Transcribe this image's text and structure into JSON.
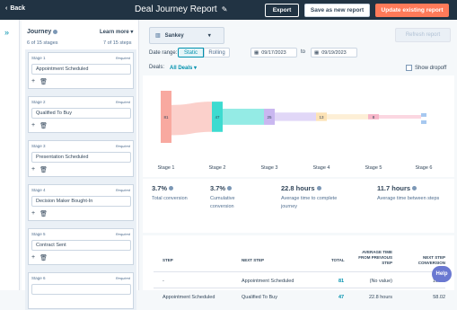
{
  "header": {
    "back_label": "Back",
    "title": "Deal Journey Report",
    "export_label": "Export",
    "save_new_label": "Save as new report",
    "update_label": "Update existing report"
  },
  "journey": {
    "title": "Journey",
    "learn_more": "Learn more",
    "stages_count": "6 of 15 stages",
    "steps_count": "7 of 15 steps",
    "required_label": "Required",
    "stages": [
      {
        "label": "Stage 1",
        "value": "Appointment Scheduled"
      },
      {
        "label": "Stage 2",
        "value": "Qualified To Buy"
      },
      {
        "label": "Stage 3",
        "value": "Presentation Scheduled"
      },
      {
        "label": "Stage 4",
        "value": "Decision Maker Bought-In"
      },
      {
        "label": "Stage 5",
        "value": "Contract Sent"
      },
      {
        "label": "Stage 6",
        "value": ""
      }
    ]
  },
  "controls": {
    "chart_type": "Sankey",
    "refresh_label": "Refresh report",
    "date_range_label": "Date range:",
    "static_label": "Static",
    "rolling_label": "Rolling",
    "start_date": "09/17/2023",
    "to_label": "to",
    "end_date": "09/19/2023",
    "deals_label": "Deals:",
    "deals_value": "All Deals",
    "show_dropoff": "Show dropoff"
  },
  "chart_data": {
    "type": "sankey",
    "stages": [
      "Stage 1",
      "Stage 2",
      "Stage 3",
      "Stage 4",
      "Stage 5",
      "Stage 6"
    ],
    "node_labels": [
      "81",
      "47",
      "25",
      "13",
      "8",
      "5"
    ],
    "node_colors": [
      "#f8a9a0",
      "#3ddbd0",
      "#c9b7f0",
      "#fce2b5",
      "#f7b6c8",
      "#a6c8f0"
    ]
  },
  "stats": [
    {
      "value": "3.7%",
      "label": "Total conversion"
    },
    {
      "value": "3.7%",
      "label": "Cumulative conversion"
    },
    {
      "value": "22.8 hours",
      "label": "Average time to complete journey"
    },
    {
      "value": "11.7 hours",
      "label": "Average time between steps"
    }
  ],
  "table": {
    "headers": [
      "Step",
      "Next step",
      "Total",
      "Average time from previous step",
      "Next step conversion"
    ],
    "rows": [
      {
        "step": "-",
        "next": "Appointment Scheduled",
        "total": "81",
        "avg": "(No value)",
        "conv": "100%"
      },
      {
        "step": "Appointment Scheduled",
        "next": "Qualified To Buy",
        "total": "47",
        "avg": "22.8 hours",
        "conv": "58.02"
      }
    ]
  },
  "help_label": "Help"
}
